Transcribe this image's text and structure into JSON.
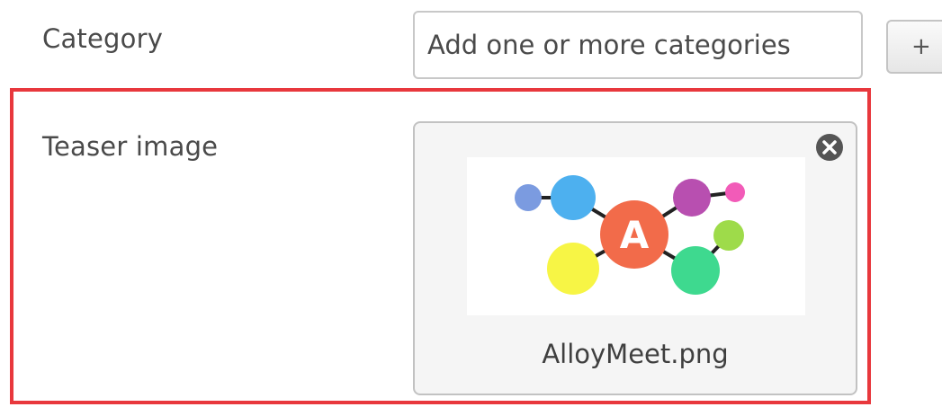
{
  "form": {
    "category": {
      "label": "Category",
      "placeholder": "Add one or more categories",
      "add_button_label": "+"
    },
    "teaser_image": {
      "label": "Teaser image",
      "file_name": "AlloyMeet.png",
      "logo_letter": "A",
      "remove_icon": "close-circle-icon"
    }
  },
  "colors": {
    "highlight": "#e8383d",
    "logo_center": "#f26b4a",
    "logo_dots": [
      "#7b9be0",
      "#4db0ef",
      "#b84fb0",
      "#f25bb8",
      "#9edb4a",
      "#f7f545",
      "#3ed98f"
    ]
  }
}
